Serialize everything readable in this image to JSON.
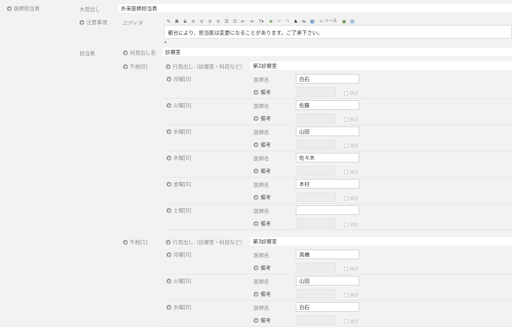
{
  "root": {
    "label": "医師担当表"
  },
  "title_field": {
    "label": "大見出し",
    "value": "外来医師担当表"
  },
  "notice": {
    "label": "注意事項",
    "editor_label": "エディタ",
    "source_label": "ソース",
    "content": "都合により、担当医は変更になることがあります。ご了承下さい。"
  },
  "doctors": {
    "label": "担当表",
    "row_heading_label": "列見出し名",
    "row_heading_value": "診療室",
    "row_heading_field_label": "行見出し（診療室・科目など）",
    "doctor_label": "医師名",
    "note_label": "備考",
    "closed_label": "休診",
    "groups": [
      {
        "label": "午前[0]",
        "heading": "第2診察室",
        "days": [
          {
            "label": "月曜[0]",
            "doctor": "白石"
          },
          {
            "label": "火曜[0]",
            "doctor": "佐藤"
          },
          {
            "label": "水曜[0]",
            "doctor": "山田"
          },
          {
            "label": "木曜[0]",
            "doctor": "佐々木"
          },
          {
            "label": "金曜[0]",
            "doctor": "木村"
          },
          {
            "label": "土曜[0]",
            "doctor": ""
          }
        ]
      },
      {
        "label": "午前[1]",
        "heading": "第3診察室",
        "days": [
          {
            "label": "月曜[0]",
            "doctor": "高橋"
          },
          {
            "label": "火曜[0]",
            "doctor": "山田"
          },
          {
            "label": "水曜[0]",
            "doctor": "白石"
          }
        ]
      }
    ]
  }
}
